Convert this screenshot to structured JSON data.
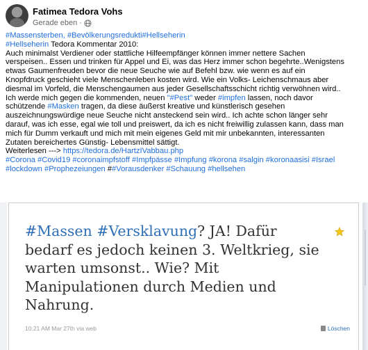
{
  "post": {
    "author": "Fatimea Tedora Vohs",
    "time": "Gerade eben",
    "separator": "·",
    "globe_icon": "globe-icon"
  },
  "text": {
    "l1_tag1": "#Massensterben,",
    "l1_tag2": "#Bevölkerungsredukti",
    "l1_tag3": "#Hellseherin",
    "l2_tag": "#Hellseherin",
    "l2_rest": " Tedora Kommentar 2010:",
    "l3": "Auch minimalst Verdiener oder stattliche Hilfeempfänger können immer nettere Sachen",
    "l4": "verspeisen.. Essen und trinken für Appel und Ei, was das Herz immer schon begehrte..Wenigstens",
    "l5": "etwas Gaumenfreuden bevor die neue Seuche wie auf Befehl bzw. wie wenn es auf ein",
    "l6": "Knopfdruck geschieht viele Menschenleben kosten wird. Wie ein Volks- Leichenschmaus aber",
    "l7": "diesmal im Vorfeld, die Menschengaumen aus jeder Gesellschaftsschicht richtig verwöhnen wird..",
    "l8_a": "Ich werde mich gegen die kommenden, neuen ",
    "l8_q": "\"#Pest\"",
    "l8_b": " weder ",
    "l8_tag": "#impfen",
    "l8_c": " lassen, noch davor",
    "l9_a": "schützende ",
    "l9_tag": "#Masken",
    "l9_b": " tragen, da diese äußerst kreative und künstlerisch gesehen",
    "l10": "auszeichnungswürdige neue Seuche nicht ansteckend sein wird.. Ich achte schon länger sehr",
    "l11": "darauf, was ich esse, egal wie toll und preiswert, da ich es nicht freiwillig zulassen kann, dass man",
    "l12": "mich für Dumm verkauft und mich mit mein eigenes Geld mit mir unbekannten, interessanten",
    "l13": "Zutaten bereichertes Günstig- Lebensmittel sättigt.",
    "l14_a": "Weiterlesen ---> ",
    "l14_link": "https://tedora.de/HartzIVabbau.php",
    "l15": "#Corona #Covid19 #coronaimpfstoff #Impfpässe #Impfung #korona #salgin #koronaasisi #Israel",
    "l16_tags1": "#lockdown #Prophezeiungen",
    "l16_hash": " #",
    "l16_tags2": "#Vorausdenker #Schauung #hellsehen"
  },
  "tweet": {
    "line1_tag1": "#Massen",
    "line1_sp": " ",
    "line1_tag2": "#Versklavung",
    "line1_rest": "? JA! Dafür",
    "line2": "bedarf es jedoch keinen 3. Weltkrieg, sie",
    "line3": "warten umsonst.. Wie? Mit",
    "line4": "Manipulationen durch Medien und",
    "line5": "Nahrung.",
    "timestamp": "10:21 AM Mar 27th via web",
    "delete_label": "Löschen",
    "star_icon": "star-icon",
    "trash_icon": "trash-icon"
  },
  "colors": {
    "link": "#216fdb",
    "tweet_hashtag": "#2f6fb5",
    "star": "#f5c518"
  }
}
